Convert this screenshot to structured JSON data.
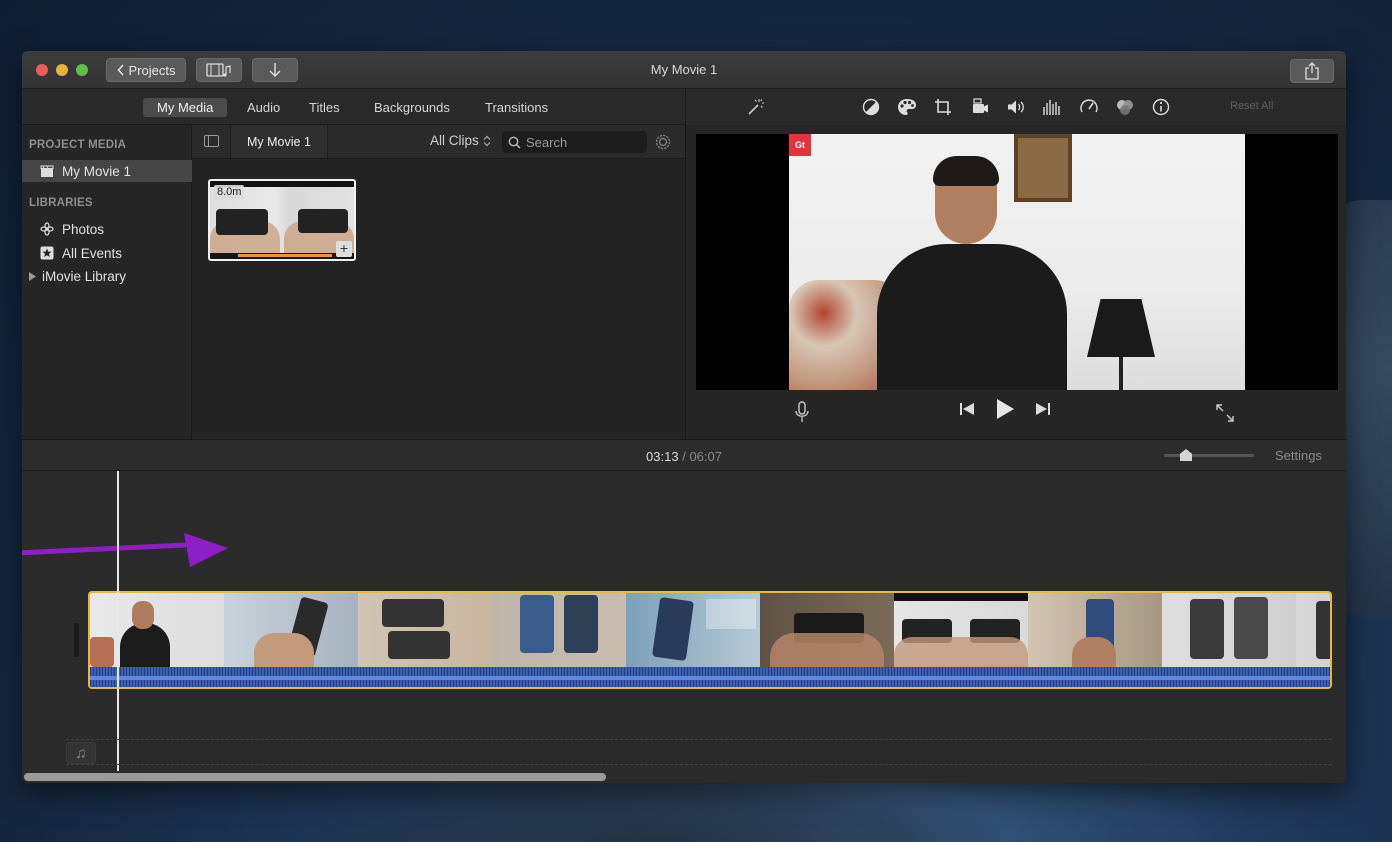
{
  "window": {
    "title": "My Movie 1"
  },
  "toolbar": {
    "projects_label": "Projects",
    "media_icon": "film-music-icon",
    "import_icon": "import-arrow-icon",
    "share_icon": "share-icon"
  },
  "browser_tabs": [
    {
      "label": "My Media",
      "active": true
    },
    {
      "label": "Audio",
      "active": false
    },
    {
      "label": "Titles",
      "active": false
    },
    {
      "label": "Backgrounds",
      "active": false
    },
    {
      "label": "Transitions",
      "active": false
    }
  ],
  "sidebar": {
    "project_media_heading": "PROJECT MEDIA",
    "project_item": "My Movie 1",
    "libraries_heading": "LIBRARIES",
    "items": [
      {
        "label": "Photos",
        "icon": "photos-icon"
      },
      {
        "label": "All Events",
        "icon": "star-icon"
      },
      {
        "label": "iMovie Library",
        "icon": "disclosure-triangle-icon"
      }
    ]
  },
  "media": {
    "crumb": "My Movie 1",
    "filter": "All Clips",
    "search_placeholder": "Search",
    "clip_duration": "8.0m",
    "clip_used_fraction": 0.68
  },
  "viewer": {
    "tools": [
      "magic-wand-icon",
      "color-balance-icon",
      "color-palette-icon",
      "crop-icon",
      "stabilization-camera-icon",
      "volume-icon",
      "equalizer-icon",
      "speed-icon",
      "filter-icon",
      "info-icon"
    ],
    "reset_label": "Reset All",
    "video_logo": "Gt"
  },
  "timeline": {
    "current_time": "03:13",
    "separator": "/",
    "total_time": "06:07",
    "settings_label": "Settings",
    "zoom_level": 0.2
  }
}
